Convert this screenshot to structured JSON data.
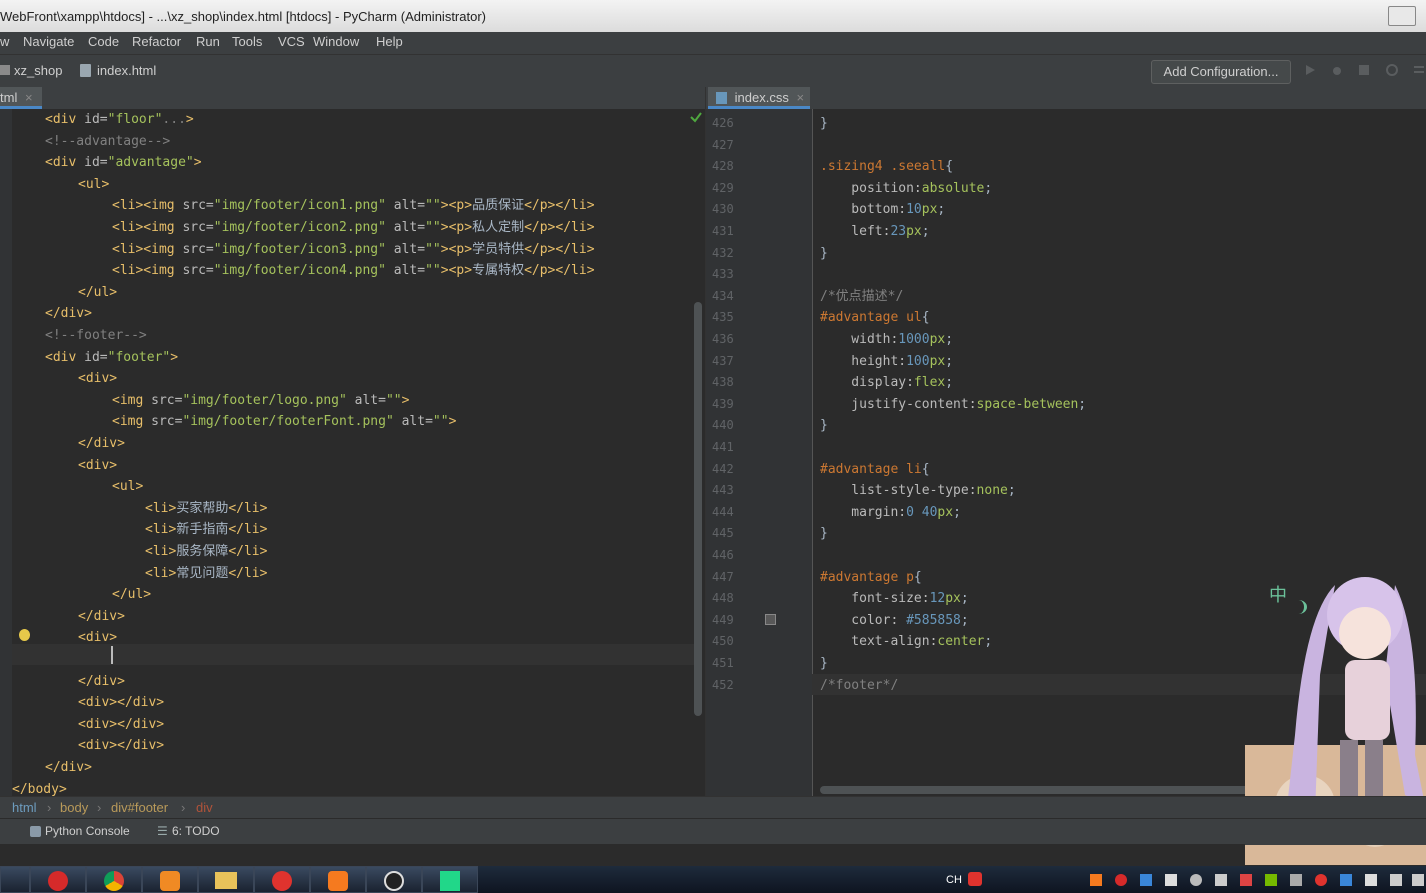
{
  "window": {
    "title": "WebFront\\xampp\\htdocs] - ...\\xz_shop\\index.html [htdocs] - PyCharm (Administrator)"
  },
  "menu": [
    "w",
    "Navigate",
    "Code",
    "Refactor",
    "Run",
    "Tools",
    "VCS",
    "Window",
    "Help"
  ],
  "nav": {
    "project": "xz_shop",
    "file": "index.html",
    "add_config": "Add Configuration..."
  },
  "tabs": {
    "left": "tml",
    "right": "index.css"
  },
  "left_code": [
    [
      [
        "tag",
        "<div "
      ],
      [
        "attr",
        "id="
      ],
      [
        "str",
        "\"floor\""
      ],
      [
        "cmt",
        "..."
      ],
      [
        "tag",
        ">"
      ]
    ],
    [
      [
        "cmt",
        "<!--advantage-->"
      ]
    ],
    [
      [
        "tag",
        "<div "
      ],
      [
        "attr",
        "id="
      ],
      [
        "str",
        "\"advantage\""
      ],
      [
        "tag",
        ">"
      ]
    ],
    [
      [
        "tag",
        "<ul>"
      ]
    ],
    [
      [
        "tag",
        "<li><img "
      ],
      [
        "attr",
        "src="
      ],
      [
        "str",
        "\"img/footer/icon1.png\""
      ],
      [
        "attr",
        " alt="
      ],
      [
        "str",
        "\"\""
      ],
      [
        "tag",
        "><p>"
      ],
      [
        "txt",
        "品质保证"
      ],
      [
        "tag",
        "</p></li>"
      ]
    ],
    [
      [
        "tag",
        "<li><img "
      ],
      [
        "attr",
        "src="
      ],
      [
        "str",
        "\"img/footer/icon2.png\""
      ],
      [
        "attr",
        " alt="
      ],
      [
        "str",
        "\"\""
      ],
      [
        "tag",
        "><p>"
      ],
      [
        "txt",
        "私人定制"
      ],
      [
        "tag",
        "</p></li>"
      ]
    ],
    [
      [
        "tag",
        "<li><img "
      ],
      [
        "attr",
        "src="
      ],
      [
        "str",
        "\"img/footer/icon3.png\""
      ],
      [
        "attr",
        " alt="
      ],
      [
        "str",
        "\"\""
      ],
      [
        "tag",
        "><p>"
      ],
      [
        "txt",
        "学员特供"
      ],
      [
        "tag",
        "</p></li>"
      ]
    ],
    [
      [
        "tag",
        "<li><img "
      ],
      [
        "attr",
        "src="
      ],
      [
        "str",
        "\"img/footer/icon4.png\""
      ],
      [
        "attr",
        " alt="
      ],
      [
        "str",
        "\"\""
      ],
      [
        "tag",
        "><p>"
      ],
      [
        "txt",
        "专属特权"
      ],
      [
        "tag",
        "</p></li>"
      ]
    ],
    [
      [
        "tag",
        "</ul>"
      ]
    ],
    [
      [
        "tag",
        "</div>"
      ]
    ],
    [
      [
        "cmt",
        "<!--footer-->"
      ]
    ],
    [
      [
        "tag",
        "<div "
      ],
      [
        "attr",
        "id="
      ],
      [
        "str",
        "\"footer\""
      ],
      [
        "tag",
        ">"
      ]
    ],
    [
      [
        "tag",
        "<div>"
      ]
    ],
    [
      [
        "tag",
        "<img "
      ],
      [
        "attr",
        "src="
      ],
      [
        "str",
        "\"img/footer/logo.png\""
      ],
      [
        "attr",
        " alt="
      ],
      [
        "str",
        "\"\""
      ],
      [
        "tag",
        ">"
      ]
    ],
    [
      [
        "tag",
        "<img "
      ],
      [
        "attr",
        "src="
      ],
      [
        "str",
        "\"img/footer/footerFont.png\""
      ],
      [
        "attr",
        " alt="
      ],
      [
        "str",
        "\"\""
      ],
      [
        "tag",
        ">"
      ]
    ],
    [
      [
        "tag",
        "</div>"
      ]
    ],
    [
      [
        "tag",
        "<div>"
      ]
    ],
    [
      [
        "tag",
        "<ul>"
      ]
    ],
    [
      [
        "tag",
        "<li>"
      ],
      [
        "txt",
        "买家帮助"
      ],
      [
        "tag",
        "</li>"
      ]
    ],
    [
      [
        "tag",
        "<li>"
      ],
      [
        "txt",
        "新手指南"
      ],
      [
        "tag",
        "</li>"
      ]
    ],
    [
      [
        "tag",
        "<li>"
      ],
      [
        "txt",
        "服务保障"
      ],
      [
        "tag",
        "</li>"
      ]
    ],
    [
      [
        "tag",
        "<li>"
      ],
      [
        "txt",
        "常见问题"
      ],
      [
        "tag",
        "</li>"
      ]
    ],
    [
      [
        "tag",
        "</ul>"
      ]
    ],
    [
      [
        "tag",
        "</div>"
      ]
    ],
    [
      [
        "tag",
        "<div>"
      ]
    ],
    [
      [
        "txt",
        ""
      ]
    ],
    [
      [
        "tag",
        "</div>"
      ]
    ],
    [
      [
        "tag",
        "<div></div>"
      ]
    ],
    [
      [
        "tag",
        "<div></div>"
      ]
    ],
    [
      [
        "tag",
        "<div></div>"
      ]
    ],
    [
      [
        "tag",
        "</div>"
      ]
    ],
    [
      [
        "tag",
        "</body>"
      ]
    ]
  ],
  "right_code": [
    {
      "n": "426",
      "t": [
        [
          "plain",
          "}"
        ]
      ]
    },
    {
      "n": "427",
      "t": []
    },
    {
      "n": "428",
      "t": [
        [
          "kw",
          ".sizing4 .seeall"
        ],
        [
          "plain",
          "{"
        ]
      ]
    },
    {
      "n": "429",
      "t": [
        [
          "prop",
          "    position:"
        ],
        [
          "val",
          "absolute"
        ],
        [
          "plain",
          ";"
        ]
      ]
    },
    {
      "n": "430",
      "t": [
        [
          "prop",
          "    bottom:"
        ],
        [
          "num",
          "10"
        ],
        [
          "val",
          "px"
        ],
        [
          "plain",
          ";"
        ]
      ]
    },
    {
      "n": "431",
      "t": [
        [
          "prop",
          "    left:"
        ],
        [
          "num",
          "23"
        ],
        [
          "val",
          "px"
        ],
        [
          "plain",
          ";"
        ]
      ]
    },
    {
      "n": "432",
      "t": [
        [
          "plain",
          "}"
        ]
      ]
    },
    {
      "n": "433",
      "t": []
    },
    {
      "n": "434",
      "t": [
        [
          "cmt",
          "/*优点描述*/"
        ]
      ]
    },
    {
      "n": "435",
      "t": [
        [
          "kw",
          "#advantage ul"
        ],
        [
          "plain",
          "{"
        ]
      ]
    },
    {
      "n": "436",
      "t": [
        [
          "prop",
          "    width:"
        ],
        [
          "num",
          "1000"
        ],
        [
          "val",
          "px"
        ],
        [
          "plain",
          ";"
        ]
      ]
    },
    {
      "n": "437",
      "t": [
        [
          "prop",
          "    height:"
        ],
        [
          "num",
          "100"
        ],
        [
          "val",
          "px"
        ],
        [
          "plain",
          ";"
        ]
      ]
    },
    {
      "n": "438",
      "t": [
        [
          "prop",
          "    display:"
        ],
        [
          "val",
          "flex"
        ],
        [
          "plain",
          ";"
        ]
      ]
    },
    {
      "n": "439",
      "t": [
        [
          "prop",
          "    justify-content:"
        ],
        [
          "val",
          "space-between"
        ],
        [
          "plain",
          ";"
        ]
      ]
    },
    {
      "n": "440",
      "t": [
        [
          "plain",
          "}"
        ]
      ]
    },
    {
      "n": "441",
      "t": []
    },
    {
      "n": "442",
      "t": [
        [
          "kw",
          "#advantage li"
        ],
        [
          "plain",
          "{"
        ]
      ]
    },
    {
      "n": "443",
      "t": [
        [
          "prop",
          "    list-style-type:"
        ],
        [
          "val",
          "none"
        ],
        [
          "plain",
          ";"
        ]
      ]
    },
    {
      "n": "444",
      "t": [
        [
          "prop",
          "    margin:"
        ],
        [
          "num",
          "0 40"
        ],
        [
          "val",
          "px"
        ],
        [
          "plain",
          ";"
        ]
      ]
    },
    {
      "n": "445",
      "t": [
        [
          "plain",
          "}"
        ]
      ]
    },
    {
      "n": "446",
      "t": []
    },
    {
      "n": "447",
      "t": [
        [
          "kw",
          "#advantage p"
        ],
        [
          "plain",
          "{"
        ]
      ]
    },
    {
      "n": "448",
      "t": [
        [
          "prop",
          "    font-size:"
        ],
        [
          "num",
          "12"
        ],
        [
          "val",
          "px"
        ],
        [
          "plain",
          ";"
        ]
      ]
    },
    {
      "n": "449",
      "t": [
        [
          "prop",
          "    color: "
        ],
        [
          "num",
          "#585858"
        ],
        [
          "plain",
          ";"
        ]
      ]
    },
    {
      "n": "450",
      "t": [
        [
          "prop",
          "    text-align:"
        ],
        [
          "val",
          "center"
        ],
        [
          "plain",
          ";"
        ]
      ]
    },
    {
      "n": "451",
      "t": [
        [
          "plain",
          "}"
        ]
      ]
    },
    {
      "n": "452",
      "t": [
        [
          "cmt",
          "/*footer*/"
        ]
      ]
    }
  ],
  "breadcrumbs": [
    "html",
    "body",
    "div#footer",
    "div"
  ],
  "bottom_tools": {
    "python_console": "Python Console",
    "todo": "6: TODO"
  },
  "tray": {
    "ime": "CH",
    "ime_float": "中"
  },
  "colors": {
    "editor_bg": "#2b2b2b",
    "panel_bg": "#3c3f41",
    "tag": "#e8bf6a",
    "string": "#a5c25c",
    "comment": "#808080",
    "number": "#6897bb",
    "keyword": "#cc7832"
  }
}
